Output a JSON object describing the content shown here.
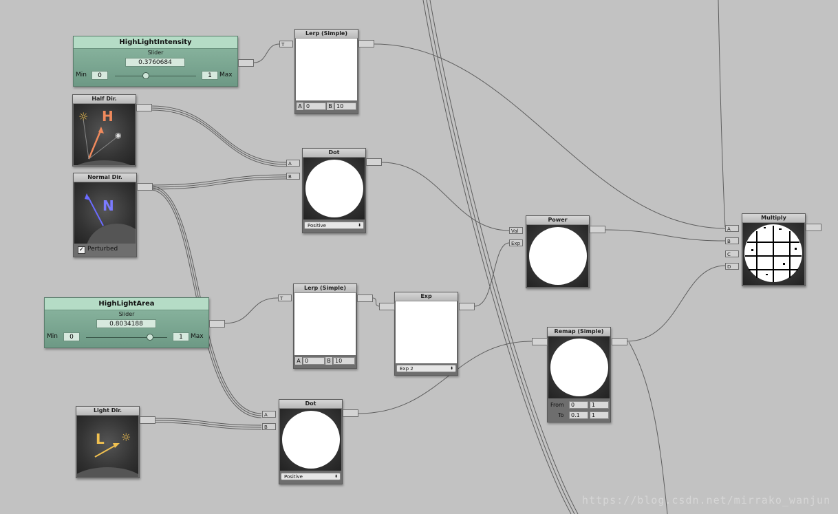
{
  "nodes": {
    "highlight_intensity": {
      "name": "HighLightIntensity",
      "type": "Slider",
      "value": "0.3760684",
      "min_label": "Min",
      "min": "0",
      "max": "1",
      "max_label": "Max",
      "level": 0.376
    },
    "highlight_area": {
      "name": "HighLightArea",
      "type": "Slider",
      "value": "0.8034188",
      "min_label": "Min",
      "min": "0",
      "max": "1",
      "max_label": "Max",
      "level": 0.803
    },
    "half_dir": {
      "title": "Half Dir.",
      "letter": "H",
      "icons": [
        "sun-icon",
        "eye-icon"
      ]
    },
    "normal_dir": {
      "title": "Normal Dir.",
      "letter": "N",
      "checkbox_label": "Perturbed",
      "checked": true
    },
    "light_dir": {
      "title": "Light Dir.",
      "letter": "L",
      "icons": [
        "sun-icon"
      ]
    },
    "lerp1": {
      "title": "Lerp (Simple)",
      "in_t": "T",
      "a_label": "A",
      "a_value": "0",
      "b_label": "B",
      "b_value": "10"
    },
    "lerp2": {
      "title": "Lerp (Simple)",
      "in_t": "T",
      "a_label": "A",
      "a_value": "0",
      "b_label": "B",
      "b_value": "10"
    },
    "dot1": {
      "title": "Dot",
      "in_a": "A",
      "in_b": "B",
      "mode": "Positive"
    },
    "dot2": {
      "title": "Dot",
      "in_a": "A",
      "in_b": "B",
      "mode": "Positive"
    },
    "exp": {
      "title": "Exp",
      "mode": "Exp 2"
    },
    "power": {
      "title": "Power",
      "in_val": "Val",
      "in_exp": "Exp"
    },
    "remap": {
      "title": "Remap (Simple)",
      "from_label": "From",
      "from_min": "0",
      "from_max": "1",
      "to_label": "To",
      "to_min": "0.1",
      "to_max": "1"
    },
    "multiply": {
      "title": "Multiply",
      "inputs": [
        "A",
        "B",
        "C",
        "D"
      ]
    }
  },
  "watermark": "https://blog.csdn.net/mirrako_wanjun",
  "colors": {
    "canvas": "#c2c2c2",
    "slider": "#8eb9a3",
    "wire": "#5e5e5e",
    "half_dir": "#f08a5d",
    "normal_dir": "#6b6bff",
    "light_dir": "#f0c050"
  }
}
